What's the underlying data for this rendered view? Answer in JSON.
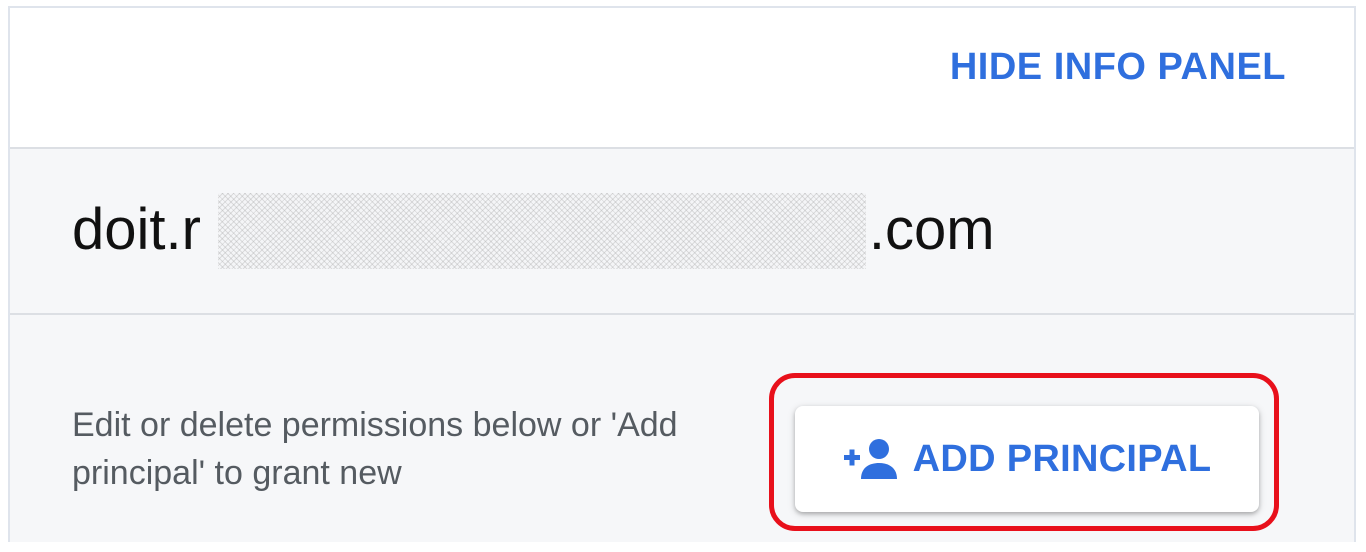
{
  "header": {
    "hide_info_panel_label": "HIDE INFO PANEL"
  },
  "account": {
    "email_visible_start": "doit.r",
    "email_visible_end": "l.com"
  },
  "actions": {
    "help_text": "Edit or delete permissions below or 'Add principal' to grant new",
    "add_principal_label": "ADD PRINCIPAL",
    "add_principal_icon": "person-add-icon"
  },
  "colors": {
    "link_blue": "#2f6fde",
    "highlight_red": "#e8101b",
    "row_background": "#f6f7f9"
  }
}
